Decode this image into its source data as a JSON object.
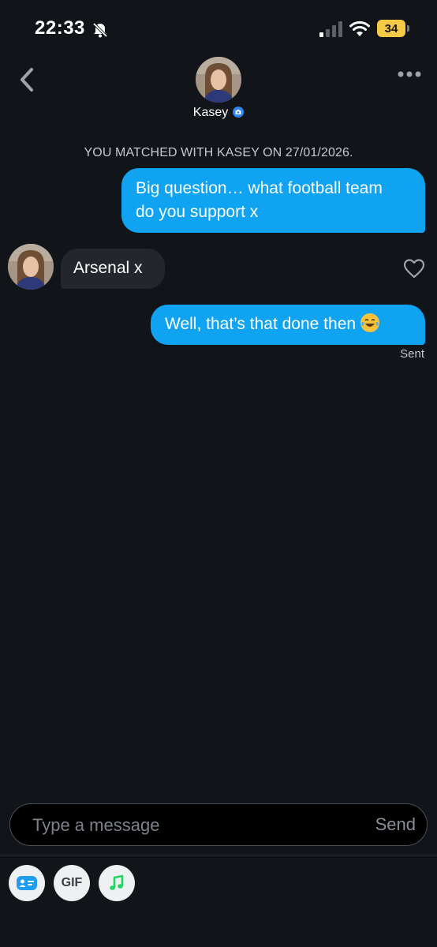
{
  "status_bar": {
    "time": "22:33",
    "battery": "34",
    "icons": [
      "bell-off-icon",
      "signal-icon",
      "wifi-icon",
      "battery-icon"
    ]
  },
  "header": {
    "name": "Kasey",
    "verified_icon": "camera-verified-icon",
    "back_icon": "chevron-left-icon",
    "more_icon": "more-dots-icon"
  },
  "chat": {
    "match_banner": "YOU MATCHED WITH KASEY ON 27/01/2026.",
    "messages": [
      {
        "from": "me",
        "lines": [
          "Big question… what football team",
          "do you support x"
        ]
      },
      {
        "from": "them",
        "text": "Arsenal x"
      },
      {
        "from": "me",
        "text": "Well, that’s that done then",
        "emoji": "face-with-tears-of-joy"
      }
    ],
    "status": "Sent"
  },
  "composer": {
    "placeholder": "Type a message",
    "send_label": "Send"
  },
  "tools": {
    "gif_label": "GIF",
    "icons": [
      "contact-card-icon",
      "gif-icon",
      "music-note-icon"
    ]
  },
  "colors": {
    "background": "#111418",
    "outgoing_bubble": "#0fa3f2",
    "incoming_bubble": "#23262d",
    "battery": "#f6c945",
    "verified": "#2f86f6",
    "music": "#1ed760"
  }
}
